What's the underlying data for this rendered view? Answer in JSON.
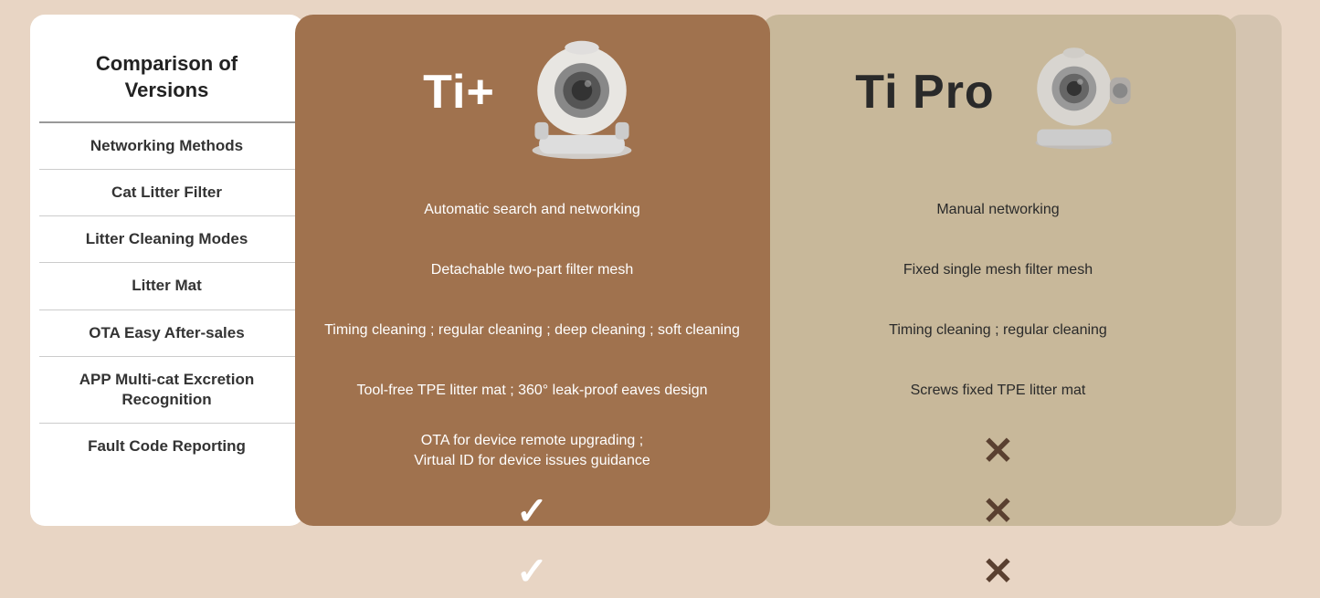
{
  "sidebar": {
    "title": "Comparison of Versions",
    "items": [
      {
        "label": "Networking Methods"
      },
      {
        "label": "Cat Litter Filter"
      },
      {
        "label": "Litter Cleaning Modes"
      },
      {
        "label": "Litter Mat"
      },
      {
        "label": "OTA Easy After-sales"
      },
      {
        "label": "APP Multi-cat Excretion Recognition"
      },
      {
        "label": "Fault Code Reporting"
      }
    ]
  },
  "tiplus": {
    "title": "Ti+",
    "features": [
      "Automatic search and networking",
      "Detachable two-part filter mesh",
      "Timing cleaning ; regular cleaning ; deep cleaning ; soft cleaning",
      "Tool-free TPE litter mat ; 360° leak-proof eaves design",
      "OTA for device remote upgrading ;\nVirtual ID for device issues guidance",
      "✓",
      "✓"
    ]
  },
  "tipro": {
    "title": "Ti Pro",
    "features": [
      "Manual networking",
      "Fixed single mesh filter mesh",
      "Timing cleaning ; regular cleaning",
      "Screws fixed TPE litter mat",
      "✗",
      "✗",
      "✗"
    ]
  }
}
